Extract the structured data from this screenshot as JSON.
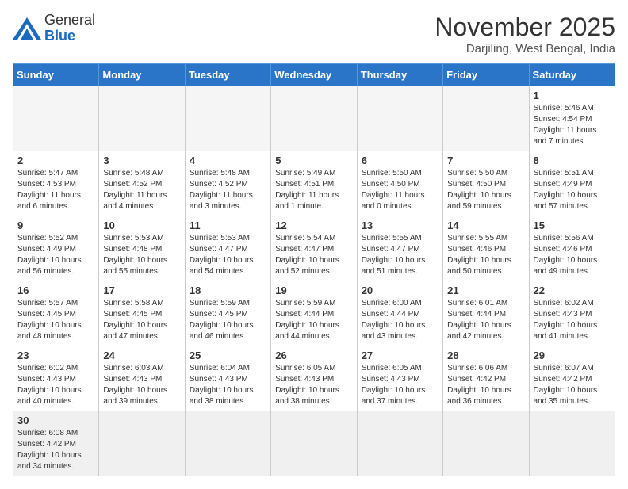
{
  "logo": {
    "general": "General",
    "blue": "Blue"
  },
  "title": "November 2025",
  "location": "Darjiling, West Bengal, India",
  "days_of_week": [
    "Sunday",
    "Monday",
    "Tuesday",
    "Wednesday",
    "Thursday",
    "Friday",
    "Saturday"
  ],
  "weeks": [
    [
      {
        "day": "",
        "info": ""
      },
      {
        "day": "",
        "info": ""
      },
      {
        "day": "",
        "info": ""
      },
      {
        "day": "",
        "info": ""
      },
      {
        "day": "",
        "info": ""
      },
      {
        "day": "",
        "info": ""
      },
      {
        "day": "1",
        "info": "Sunrise: 5:46 AM\nSunset: 4:54 PM\nDaylight: 11 hours and 7 minutes."
      }
    ],
    [
      {
        "day": "2",
        "info": "Sunrise: 5:47 AM\nSunset: 4:53 PM\nDaylight: 11 hours and 6 minutes."
      },
      {
        "day": "3",
        "info": "Sunrise: 5:48 AM\nSunset: 4:52 PM\nDaylight: 11 hours and 4 minutes."
      },
      {
        "day": "4",
        "info": "Sunrise: 5:48 AM\nSunset: 4:52 PM\nDaylight: 11 hours and 3 minutes."
      },
      {
        "day": "5",
        "info": "Sunrise: 5:49 AM\nSunset: 4:51 PM\nDaylight: 11 hours and 1 minute."
      },
      {
        "day": "6",
        "info": "Sunrise: 5:50 AM\nSunset: 4:50 PM\nDaylight: 11 hours and 0 minutes."
      },
      {
        "day": "7",
        "info": "Sunrise: 5:50 AM\nSunset: 4:50 PM\nDaylight: 10 hours and 59 minutes."
      },
      {
        "day": "8",
        "info": "Sunrise: 5:51 AM\nSunset: 4:49 PM\nDaylight: 10 hours and 57 minutes."
      }
    ],
    [
      {
        "day": "9",
        "info": "Sunrise: 5:52 AM\nSunset: 4:49 PM\nDaylight: 10 hours and 56 minutes."
      },
      {
        "day": "10",
        "info": "Sunrise: 5:53 AM\nSunset: 4:48 PM\nDaylight: 10 hours and 55 minutes."
      },
      {
        "day": "11",
        "info": "Sunrise: 5:53 AM\nSunset: 4:47 PM\nDaylight: 10 hours and 54 minutes."
      },
      {
        "day": "12",
        "info": "Sunrise: 5:54 AM\nSunset: 4:47 PM\nDaylight: 10 hours and 52 minutes."
      },
      {
        "day": "13",
        "info": "Sunrise: 5:55 AM\nSunset: 4:47 PM\nDaylight: 10 hours and 51 minutes."
      },
      {
        "day": "14",
        "info": "Sunrise: 5:55 AM\nSunset: 4:46 PM\nDaylight: 10 hours and 50 minutes."
      },
      {
        "day": "15",
        "info": "Sunrise: 5:56 AM\nSunset: 4:46 PM\nDaylight: 10 hours and 49 minutes."
      }
    ],
    [
      {
        "day": "16",
        "info": "Sunrise: 5:57 AM\nSunset: 4:45 PM\nDaylight: 10 hours and 48 minutes."
      },
      {
        "day": "17",
        "info": "Sunrise: 5:58 AM\nSunset: 4:45 PM\nDaylight: 10 hours and 47 minutes."
      },
      {
        "day": "18",
        "info": "Sunrise: 5:59 AM\nSunset: 4:45 PM\nDaylight: 10 hours and 46 minutes."
      },
      {
        "day": "19",
        "info": "Sunrise: 5:59 AM\nSunset: 4:44 PM\nDaylight: 10 hours and 44 minutes."
      },
      {
        "day": "20",
        "info": "Sunrise: 6:00 AM\nSunset: 4:44 PM\nDaylight: 10 hours and 43 minutes."
      },
      {
        "day": "21",
        "info": "Sunrise: 6:01 AM\nSunset: 4:44 PM\nDaylight: 10 hours and 42 minutes."
      },
      {
        "day": "22",
        "info": "Sunrise: 6:02 AM\nSunset: 4:43 PM\nDaylight: 10 hours and 41 minutes."
      }
    ],
    [
      {
        "day": "23",
        "info": "Sunrise: 6:02 AM\nSunset: 4:43 PM\nDaylight: 10 hours and 40 minutes."
      },
      {
        "day": "24",
        "info": "Sunrise: 6:03 AM\nSunset: 4:43 PM\nDaylight: 10 hours and 39 minutes."
      },
      {
        "day": "25",
        "info": "Sunrise: 6:04 AM\nSunset: 4:43 PM\nDaylight: 10 hours and 38 minutes."
      },
      {
        "day": "26",
        "info": "Sunrise: 6:05 AM\nSunset: 4:43 PM\nDaylight: 10 hours and 38 minutes."
      },
      {
        "day": "27",
        "info": "Sunrise: 6:05 AM\nSunset: 4:43 PM\nDaylight: 10 hours and 37 minutes."
      },
      {
        "day": "28",
        "info": "Sunrise: 6:06 AM\nSunset: 4:42 PM\nDaylight: 10 hours and 36 minutes."
      },
      {
        "day": "29",
        "info": "Sunrise: 6:07 AM\nSunset: 4:42 PM\nDaylight: 10 hours and 35 minutes."
      }
    ],
    [
      {
        "day": "30",
        "info": "Sunrise: 6:08 AM\nSunset: 4:42 PM\nDaylight: 10 hours and 34 minutes."
      },
      {
        "day": "",
        "info": ""
      },
      {
        "day": "",
        "info": ""
      },
      {
        "day": "",
        "info": ""
      },
      {
        "day": "",
        "info": ""
      },
      {
        "day": "",
        "info": ""
      },
      {
        "day": "",
        "info": ""
      }
    ]
  ]
}
